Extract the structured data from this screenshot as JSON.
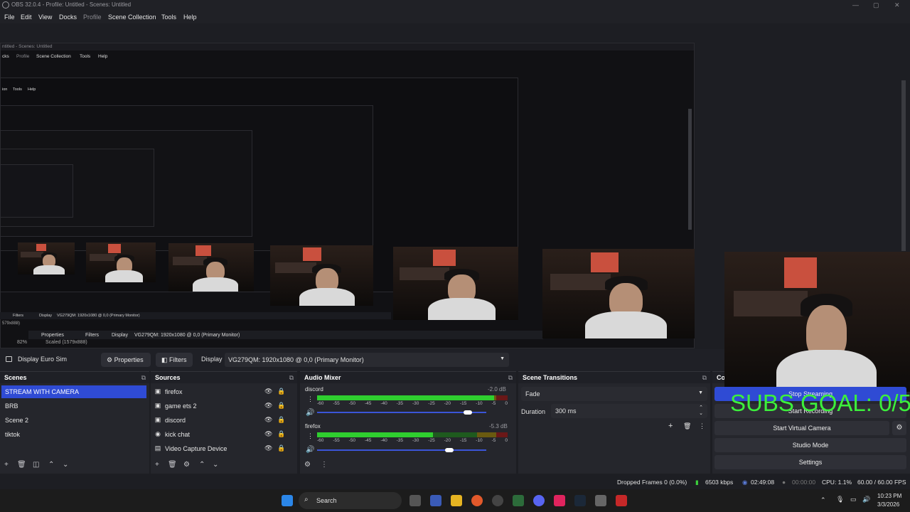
{
  "window": {
    "title": "OBS 32.0.4 - Profile: Untitled - Scenes: Untitled",
    "minimize": "—",
    "maximize": "▢",
    "close": "✕"
  },
  "menu": [
    "File",
    "Edit",
    "View",
    "Docks",
    "Profile",
    "Scene Collection",
    "Tools",
    "Help"
  ],
  "nested_preview": {
    "title_1": "ntitled - Scenes: Untitled",
    "menu_1": [
      "cks",
      "Profile",
      "Scene Collection",
      "Tools",
      "Help"
    ],
    "menu_2": [
      "ion",
      "Tools",
      "Help"
    ],
    "props_1": "Properties",
    "filters_1": "Filters",
    "display_1": "Display",
    "monitor_1": "VG279QM: 1920x1080 @ 0,0 (Primary Monitor)",
    "zoom": "82%",
    "scaled": "Scaled (1579x888)",
    "scaled_2": "579x888)",
    "filters_2": "Filters",
    "display_2": "Display",
    "monitor_2": "VG279QM: 1920x1080 @ 0,0 (Primary Monitor)"
  },
  "overlay": {
    "subs_goal": "SUBS GOAL: 0/5"
  },
  "source_bar": {
    "source_name": "Display Euro Sim",
    "properties": "Properties",
    "filters": "Filters",
    "display_label": "Display",
    "display_value": "VG279QM: 1920x1080 @ 0,0 (Primary Monitor)"
  },
  "scenes": {
    "title": "Scenes",
    "items": [
      "STREAM WITH CAMERA",
      "BRB",
      "Scene 2",
      "tiktok"
    ],
    "selected": "STREAM WITH CAMERA"
  },
  "sources": {
    "title": "Sources",
    "items": [
      {
        "name": "firefox",
        "icon": "window-capture-icon"
      },
      {
        "name": "game ets 2",
        "icon": "window-capture-icon"
      },
      {
        "name": "discord",
        "icon": "window-capture-icon"
      },
      {
        "name": "kick chat",
        "icon": "browser-source-icon"
      },
      {
        "name": "Video Capture Device",
        "icon": "camera-icon"
      }
    ]
  },
  "audio": {
    "title": "Audio Mixer",
    "channels": [
      {
        "name": "discord",
        "db": "-2.0 dB",
        "level": 0.93,
        "volume": 0.89
      },
      {
        "name": "firefox",
        "db": "-5.3 dB",
        "level": 0.61,
        "volume": 0.78
      }
    ],
    "ticks": [
      "-60",
      "-55",
      "-50",
      "-45",
      "-40",
      "-35",
      "-30",
      "-25",
      "-20",
      "-15",
      "-10",
      "-5",
      "0"
    ]
  },
  "transitions": {
    "title": "Scene Transitions",
    "type": "Fade",
    "duration_label": "Duration",
    "duration_value": "300 ms"
  },
  "controls": {
    "title": "Co",
    "stop_streaming": "Stop Streaming",
    "start_recording": "Start Recording",
    "virtual_camera": "Start Virtual Camera",
    "studio_mode": "Studio Mode",
    "settings": "Settings"
  },
  "status": {
    "dropped": "Dropped Frames 0 (0.0%)",
    "bitrate": "6503 kbps",
    "stream_time": "02:49:08",
    "rec_time": "00:00:00",
    "cpu": "CPU: 1.1%",
    "fps": "60.00 / 60.00 FPS"
  },
  "taskbar": {
    "search": "Search",
    "time": "10:23 PM",
    "date": "3/3/2026"
  },
  "colors": {
    "accent": "#2f4bd4",
    "meter_green": "#2fce2f",
    "subs_green": "#3cf03c",
    "panel": "#25262c"
  }
}
